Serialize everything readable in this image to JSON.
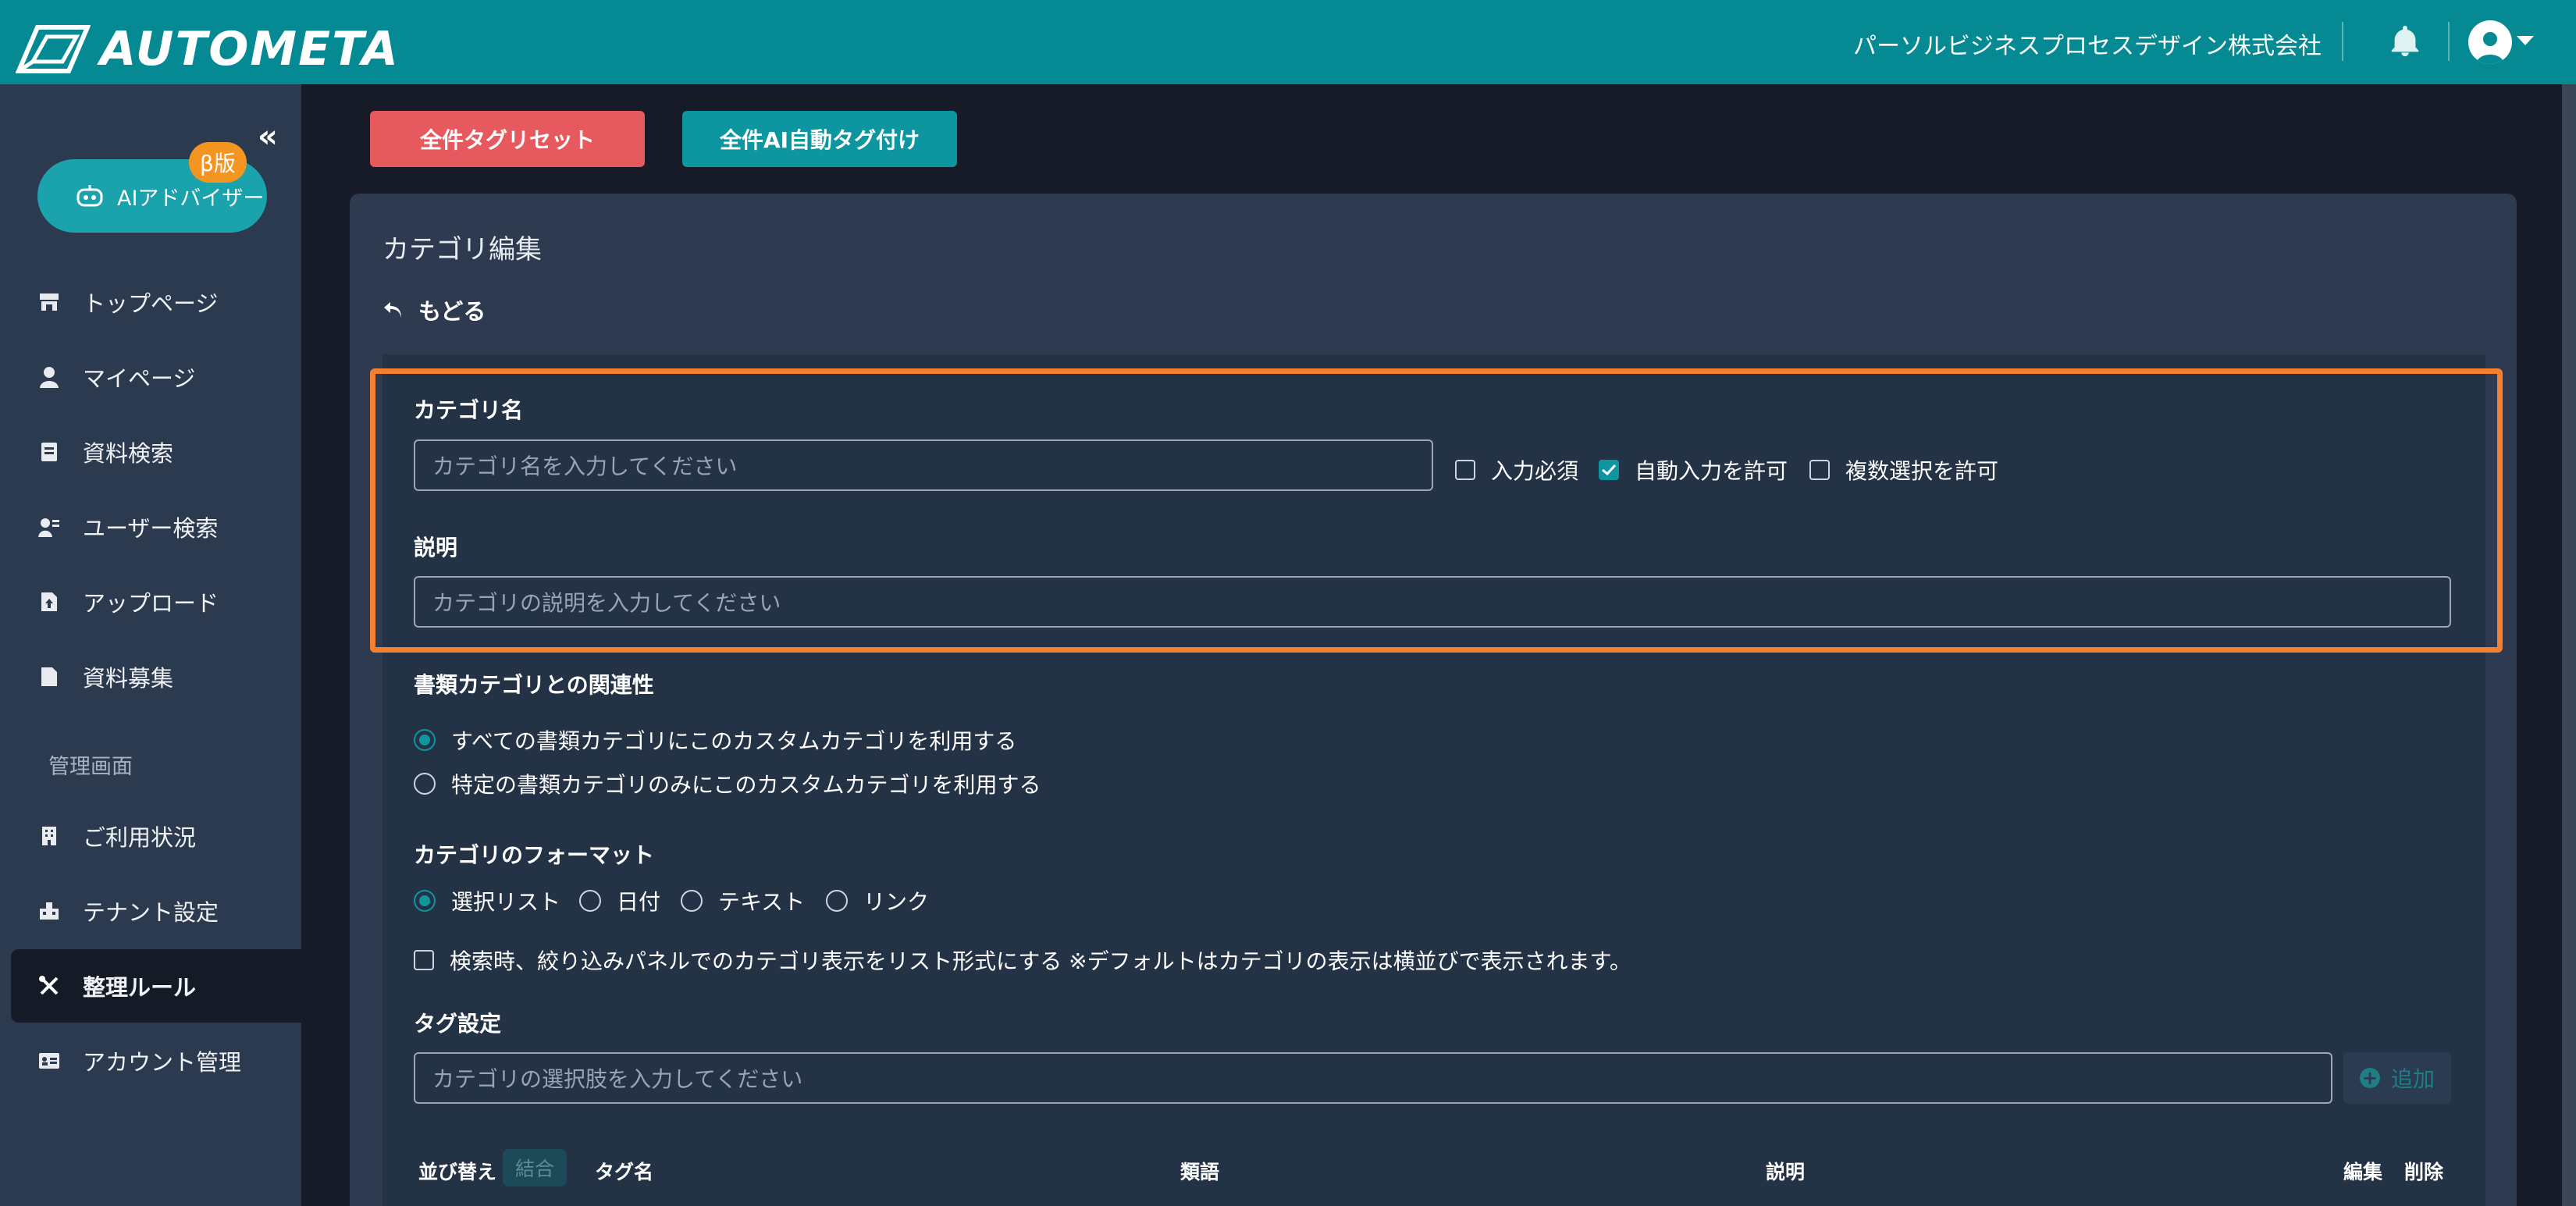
{
  "header": {
    "brand": "AUTOMETA",
    "company": "パーソルビジネスプロセスデザイン株式会社",
    "icons": [
      "logo-icon",
      "bell-icon",
      "user-icon",
      "chevron-down-icon"
    ]
  },
  "sidebar": {
    "ai_label": "AIアドバイザー",
    "beta_label": "β版",
    "items": [
      {
        "label": "トップページ",
        "icon": "store-icon"
      },
      {
        "label": "マイページ",
        "icon": "person-icon"
      },
      {
        "label": "資料検索",
        "icon": "document-search-icon"
      },
      {
        "label": "ユーザー検索",
        "icon": "user-search-icon"
      },
      {
        "label": "アップロード",
        "icon": "upload-icon"
      },
      {
        "label": "資料募集",
        "icon": "file-icon"
      }
    ],
    "admin_section": "管理画面",
    "admin_items": [
      {
        "label": "ご利用状況",
        "icon": "building-icon"
      },
      {
        "label": "テナント設定",
        "icon": "tenant-icon"
      },
      {
        "label": "整理ルール",
        "icon": "tools-icon",
        "active": true
      },
      {
        "label": "アカウント管理",
        "icon": "id-card-icon"
      }
    ]
  },
  "toolbar": {
    "reset_label": "全件タグリセット",
    "ai_tag_label": "全件AI自動タグ付け"
  },
  "page": {
    "title": "カテゴリ編集",
    "back_label": "もどる"
  },
  "form": {
    "name_label": "カテゴリ名",
    "name_placeholder": "カテゴリ名を入力してください",
    "required_label": "入力必須",
    "auto_input_label": "自動入力を許可",
    "multi_select_label": "複数選択を許可",
    "auto_input_checked": true,
    "desc_label": "説明",
    "desc_placeholder": "カテゴリの説明を入力してください",
    "relation_label": "書類カテゴリとの関連性",
    "relation_all": "すべての書類カテゴリにこのカスタムカテゴリを利用する",
    "relation_specific": "特定の書類カテゴリのみにこのカスタムカテゴリを利用する",
    "format_label": "カテゴリのフォーマット",
    "format_options": [
      "選択リスト",
      "日付",
      "テキスト",
      "リンク"
    ],
    "format_selected": "選択リスト",
    "list_display_label": "検索時、絞り込みパネルでのカテゴリ表示をリスト形式にする ※デフォルトはカテゴリの表示は横並びで表示されます。",
    "tag_label": "タグ設定",
    "tag_placeholder": "カテゴリの選択肢を入力してください",
    "add_label": "追加"
  },
  "table": {
    "sort": "並び替え",
    "merge": "結合",
    "tag_name": "タグ名",
    "synonyms": "類語",
    "description": "説明",
    "edit": "編集",
    "delete": "削除"
  },
  "colors": {
    "header": "#058a93",
    "sidebar": "#2c3a4f",
    "accent": "#0e96a0",
    "danger": "#e65a5f",
    "highlight": "#f47f2e",
    "beta": "#f39520"
  }
}
